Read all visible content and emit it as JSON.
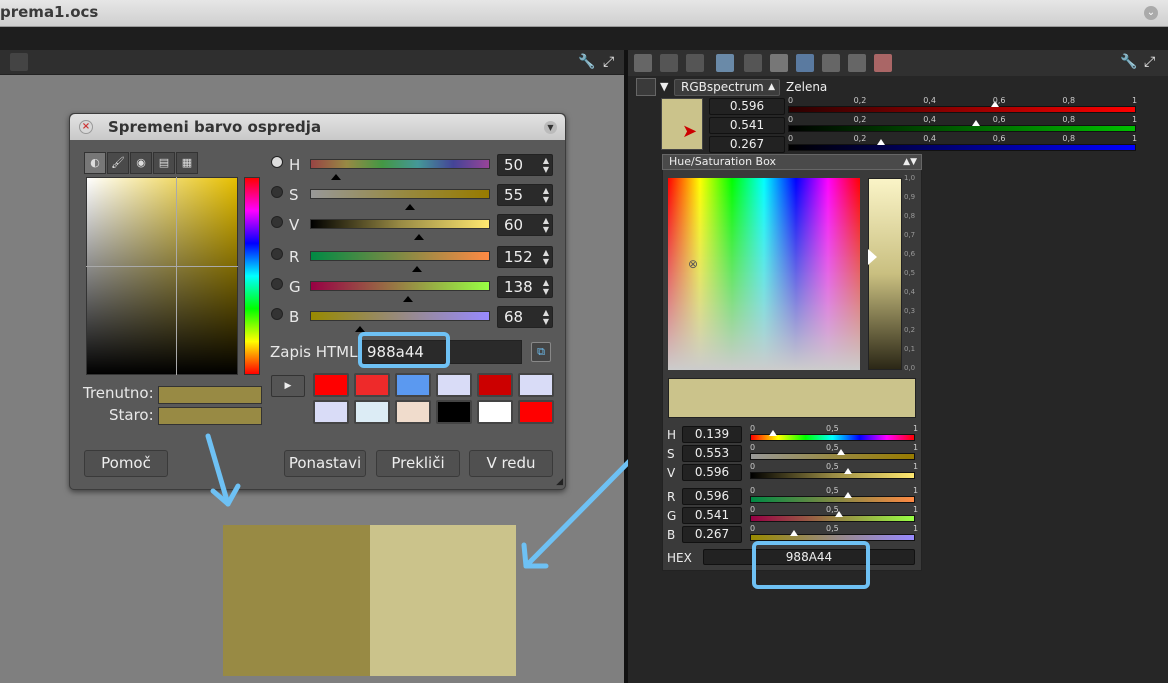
{
  "window": {
    "title": "prema1.ocs"
  },
  "dialog": {
    "title": "Spremeni barvo ospredja",
    "sliders": [
      {
        "label": "H",
        "value": "50",
        "pos": 0.14
      },
      {
        "label": "S",
        "value": "55",
        "pos": 0.55
      },
      {
        "label": "V",
        "value": "60",
        "pos": 0.6
      },
      {
        "label": "R",
        "value": "152",
        "pos": 0.59
      },
      {
        "label": "G",
        "value": "138",
        "pos": 0.54
      },
      {
        "label": "B",
        "value": "68",
        "pos": 0.27
      }
    ],
    "html_label": "Zapis HTML:",
    "html_value": "988a44",
    "current_label": "Trenutno:",
    "old_label": "Staro:",
    "current_color": "#988a44",
    "old_color": "#988a44",
    "palette": [
      [
        "#ff0000",
        "#ee2a2a",
        "#5b99f0",
        "#d9dcf7",
        "#cc0000",
        "#d9dcf7"
      ],
      [
        "#d9dcf7",
        "#dcecf5",
        "#f0dccc",
        "#000000",
        "#ffffff",
        "#ff0000"
      ]
    ],
    "buttons": {
      "help": "Pomoč",
      "reset": "Ponastavi",
      "cancel": "Prekliči",
      "ok": "V redu"
    }
  },
  "compare": {
    "old": "#988a44",
    "new": "#cbc38b"
  },
  "right_panel": {
    "mode": "RGBspectrum",
    "channel_name": "Zelena",
    "rgb_values": [
      "0.596",
      "0.541",
      "0.267"
    ],
    "ticks": [
      "0",
      "0,2",
      "0,4",
      "0,6",
      "0,8",
      "1"
    ],
    "hsb_title": "Hue/Saturation Box",
    "vticks": [
      "1,0",
      "0,9",
      "0,8",
      "0,7",
      "0,6",
      "0,5",
      "0,4",
      "0,3",
      "0,2",
      "0,1",
      "0,0"
    ],
    "rows": [
      {
        "label": "H",
        "value": "0.139"
      },
      {
        "label": "S",
        "value": "0.553"
      },
      {
        "label": "V",
        "value": "0.596"
      },
      {
        "label": "R",
        "value": "0.596"
      },
      {
        "label": "G",
        "value": "0.541"
      },
      {
        "label": "B",
        "value": "0.267"
      }
    ],
    "mticks": [
      "0",
      "0,5",
      "1"
    ],
    "hex_label": "HEX",
    "hex_value": "988A44",
    "swatch_color": "#cbc38b"
  }
}
